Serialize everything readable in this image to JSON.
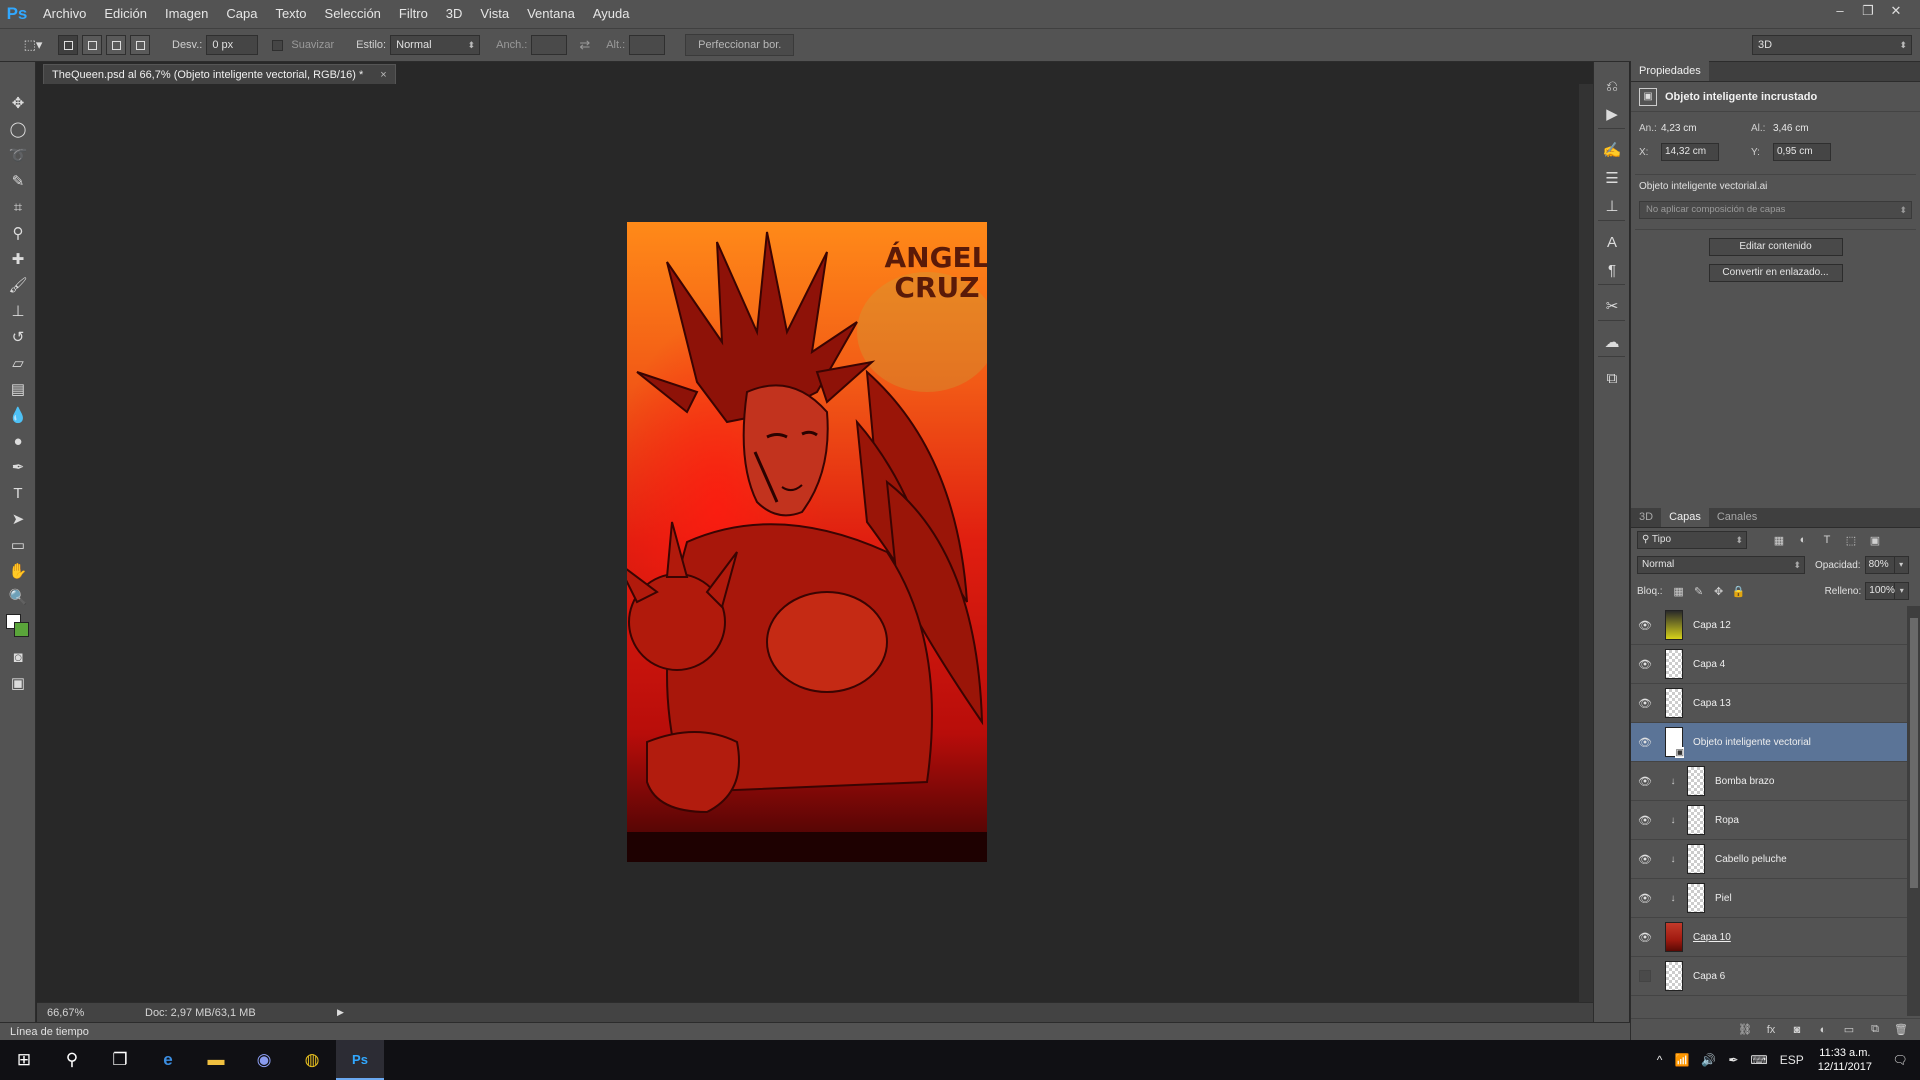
{
  "app": {
    "logo": "Ps",
    "menu": [
      "Archivo",
      "Edición",
      "Imagen",
      "Capa",
      "Texto",
      "Selección",
      "Filtro",
      "3D",
      "Vista",
      "Ventana",
      "Ayuda"
    ],
    "window_controls": {
      "minimize": "–",
      "restore": "❐",
      "close": "✕"
    }
  },
  "options_bar": {
    "feather_label": "Desv.:",
    "feather_value": "0 px",
    "antialias_label": "Suavizar",
    "style_label": "Estilo:",
    "style_value": "Normal",
    "width_label": "Anch.:",
    "height_label": "Alt.:",
    "refine_label": "Perfeccionar bor.",
    "workspace_value": "3D"
  },
  "document": {
    "tab_title": "TheQueen.psd al 66,7% (Objeto inteligente vectorial, RGB/16) *",
    "tab_close": "×",
    "zoom": "66,67%",
    "doc_size": "Doc: 2,97 MB/63,1 MB",
    "artwork_text_line1": "ÁNGEL",
    "artwork_text_line2": "CRUZ"
  },
  "timeline": {
    "label": "Línea de tiempo"
  },
  "properties": {
    "tab": "Propiedades",
    "header": "Objeto inteligente incrustado",
    "width_label": "An.:",
    "width_value": "4,23 cm",
    "height_label": "Al.:",
    "height_value": "3,46 cm",
    "x_label": "X:",
    "x_value": "14,32 cm",
    "y_label": "Y:",
    "y_value": "0,95 cm",
    "source_name": "Objeto inteligente vectorial.ai",
    "comp_select": "No aplicar composición de capas",
    "edit_button": "Editar contenido",
    "convert_button": "Convertir en enlazado..."
  },
  "layers_panel": {
    "tabs": [
      "3D",
      "Capas",
      "Canales"
    ],
    "active_tab": "Capas",
    "kind_filter": "Tipo",
    "blend_mode": "Normal",
    "opacity_label": "Opacidad:",
    "opacity_value": "80%",
    "lock_label": "Bloq.:",
    "fill_label": "Relleno:",
    "fill_value": "100%",
    "layers": [
      {
        "name": "Capa 12",
        "visible": true,
        "thumb": "grad",
        "clipped": false,
        "selected": false,
        "underline": false
      },
      {
        "name": "Capa 4",
        "visible": true,
        "thumb": "transparent",
        "clipped": false,
        "selected": false,
        "underline": false
      },
      {
        "name": "Capa 13",
        "visible": true,
        "thumb": "transparent",
        "clipped": false,
        "selected": false,
        "underline": false
      },
      {
        "name": "Objeto inteligente vectorial",
        "visible": true,
        "thumb": "sobj",
        "clipped": false,
        "selected": true,
        "underline": false
      },
      {
        "name": "Bomba brazo",
        "visible": true,
        "thumb": "transparent",
        "clipped": true,
        "selected": false,
        "underline": false
      },
      {
        "name": "Ropa",
        "visible": true,
        "thumb": "transparent",
        "clipped": true,
        "selected": false,
        "underline": false
      },
      {
        "name": "Cabello peluche",
        "visible": true,
        "thumb": "transparent",
        "clipped": true,
        "selected": false,
        "underline": false
      },
      {
        "name": "Piel",
        "visible": true,
        "thumb": "transparent",
        "clipped": true,
        "selected": false,
        "underline": false
      },
      {
        "name": "Capa 10",
        "visible": true,
        "thumb": "red",
        "clipped": false,
        "selected": false,
        "underline": true
      },
      {
        "name": "Capa 6",
        "visible": false,
        "thumb": "transparent",
        "clipped": false,
        "selected": false,
        "underline": false
      }
    ]
  },
  "taskbar": {
    "language": "ESP",
    "time": "11:33 a.m.",
    "date": "12/11/2017"
  },
  "colors": {
    "foreground": "#ffffff",
    "background": "#5aa53a",
    "selected_layer": "#5b7497"
  }
}
